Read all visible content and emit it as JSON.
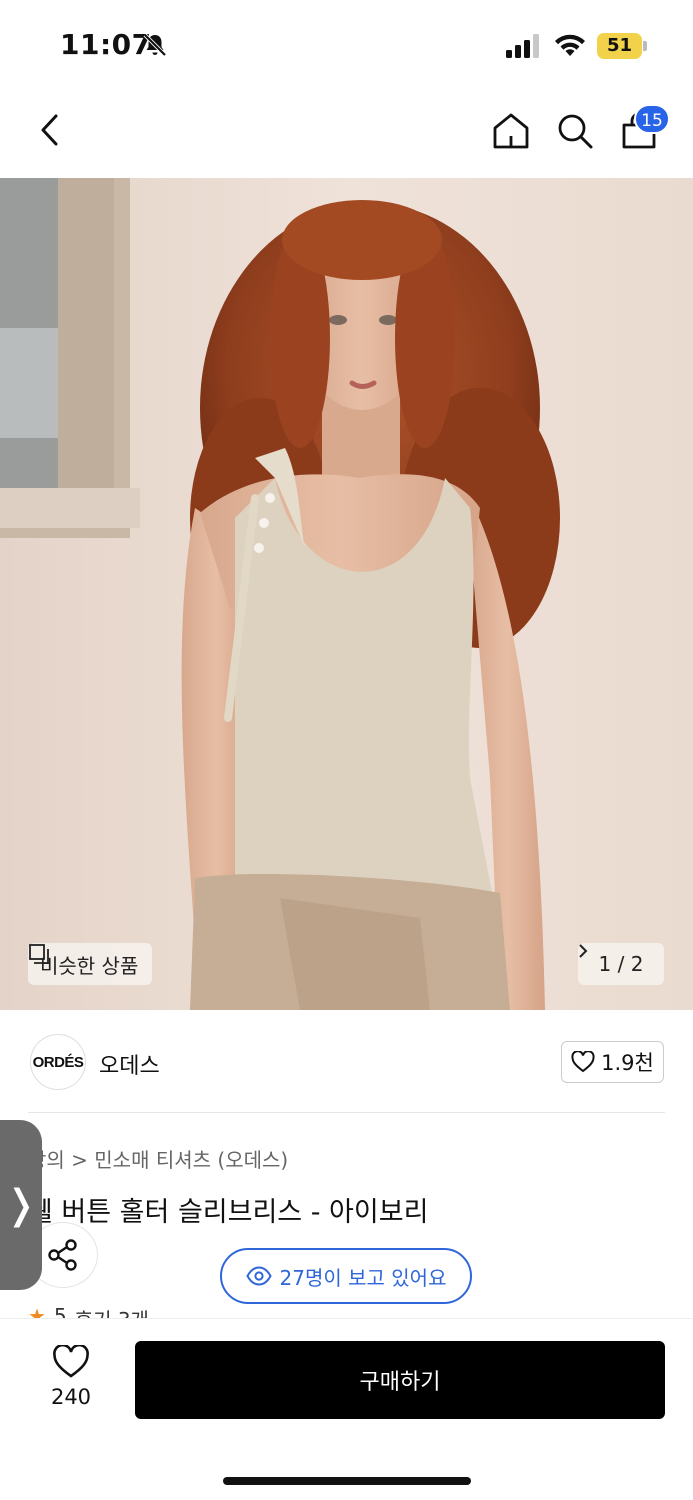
{
  "status_bar": {
    "time": "11:07",
    "battery": "51"
  },
  "header": {
    "cart_count": "15"
  },
  "gallery": {
    "similar_label": "비슷한 상품",
    "pager": "1 / 2"
  },
  "brand": {
    "logo_text": "ORDÉS",
    "name": "오데스",
    "likes": "1.9천"
  },
  "product": {
    "breadcrumb": "상의 > 민소매 티셔츠 (오데스)",
    "title": "쉘 버튼 홀터 슬리브리스 - 아이보리",
    "viewers": "27명이 보고 있어요",
    "rating": "5",
    "reviews": "후기 3개"
  },
  "bottom": {
    "wish_count": "240",
    "buy_label": "구매하기"
  },
  "colors": {
    "accent": "#2f66d9",
    "badge": "#2864e8",
    "buy_button": "#000000",
    "star": "#f08a1c"
  },
  "icons": [
    "bell-off-icon",
    "signal-icon",
    "wifi-icon",
    "battery-icon",
    "back-icon",
    "home-icon",
    "search-icon",
    "shopping-bag-icon",
    "similar-items-icon",
    "heart-icon",
    "share-icon",
    "eye-icon",
    "star-icon",
    "chevron-right-icon"
  ]
}
